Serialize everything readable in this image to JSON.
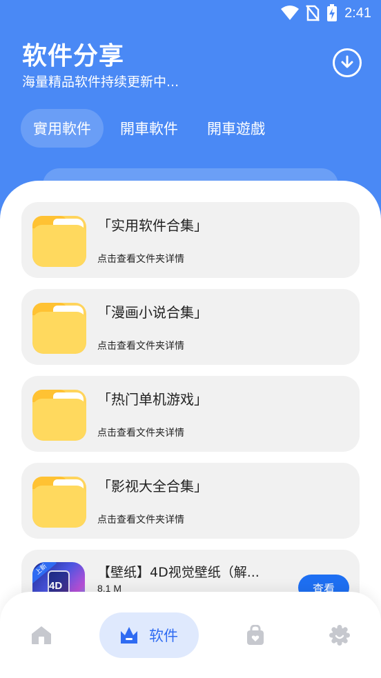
{
  "status_bar": {
    "time": "2:41"
  },
  "header": {
    "title": "软件分享",
    "subtitle": "海量精品软件持续更新中..."
  },
  "tabs": [
    {
      "label": "實用軟件",
      "active": true
    },
    {
      "label": "開車軟件",
      "active": false
    },
    {
      "label": "開車遊戲",
      "active": false
    }
  ],
  "folders": [
    {
      "title": "「实用软件合集」",
      "subtitle": "点击查看文件夹详情"
    },
    {
      "title": "「漫画小说合集」",
      "subtitle": "点击查看文件夹详情"
    },
    {
      "title": "「热门单机游戏」",
      "subtitle": "点击查看文件夹详情"
    },
    {
      "title": "「影视大全合集」",
      "subtitle": "点击查看文件夹详情"
    }
  ],
  "app_item": {
    "title": "【壁纸】4D视觉壁纸（解...",
    "size": "8.1 M",
    "button_label": "查看",
    "icon_badge": "4D",
    "icon_ribbon": "上新"
  },
  "bottom_nav": {
    "active_label": "软件",
    "items": [
      "home-icon",
      "software-icon",
      "bag-icon",
      "settings-icon"
    ]
  },
  "colors": {
    "primary": "#4a89f5",
    "accent": "#2f6bf2",
    "folder": "#ffd45c",
    "card_bg": "#f1f1f1"
  }
}
